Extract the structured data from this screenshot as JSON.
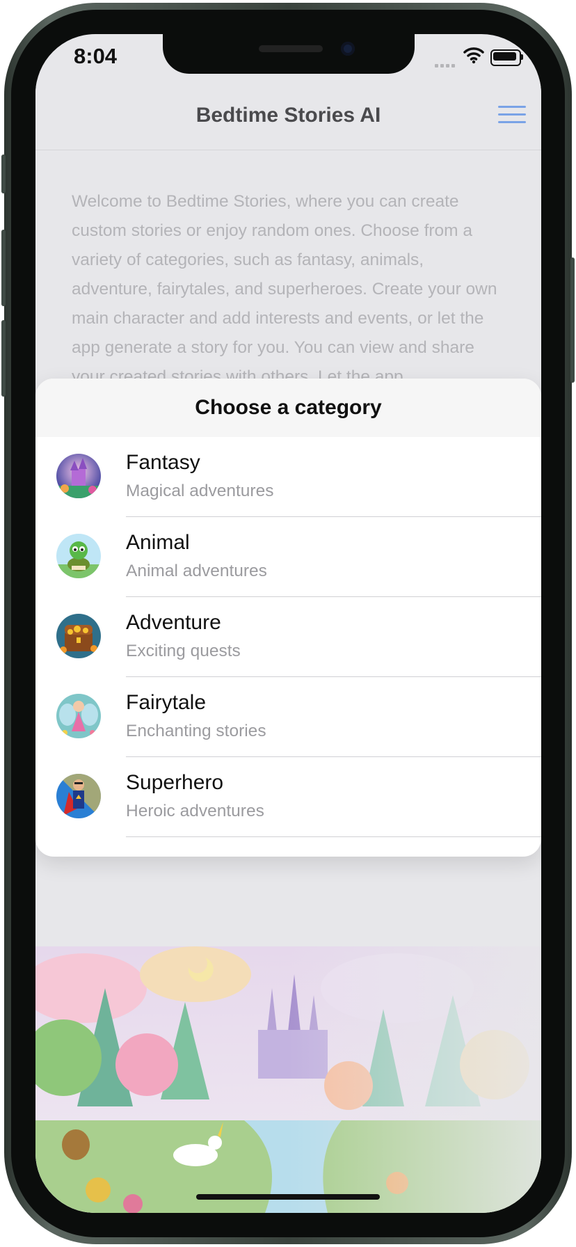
{
  "status_bar": {
    "time": "8:04"
  },
  "nav": {
    "title": "Bedtime Stories AI"
  },
  "intro": {
    "text": "Welcome to Bedtime Stories, where you can create custom stories or enjoy random ones. Choose from a variety of categories, such as fantasy, animals, adventure, fairytales, and superheroes. Create your own main character and add interests and events, or let the app generate a story for you. You can view and share your created stories with others. Let the app"
  },
  "sheet": {
    "title": "Choose a category",
    "categories": [
      {
        "title": "Fantasy",
        "subtitle": "Magical adventures",
        "icon": "castle-icon",
        "color": "#6a5acd"
      },
      {
        "title": "Animal",
        "subtitle": "Animal adventures",
        "icon": "turtle-icon",
        "color": "#3cb371"
      },
      {
        "title": "Adventure",
        "subtitle": "Exciting quests",
        "icon": "treasure-chest-icon",
        "color": "#d2691e"
      },
      {
        "title": "Fairytale",
        "subtitle": "Enchanting stories",
        "icon": "fairy-icon",
        "color": "#20b2aa"
      },
      {
        "title": "Superhero",
        "subtitle": "Heroic adventures",
        "icon": "superhero-icon",
        "color": "#1e3a8a"
      }
    ]
  },
  "colors": {
    "accent": "#7aa3e6",
    "background": "#e7e7ea"
  }
}
